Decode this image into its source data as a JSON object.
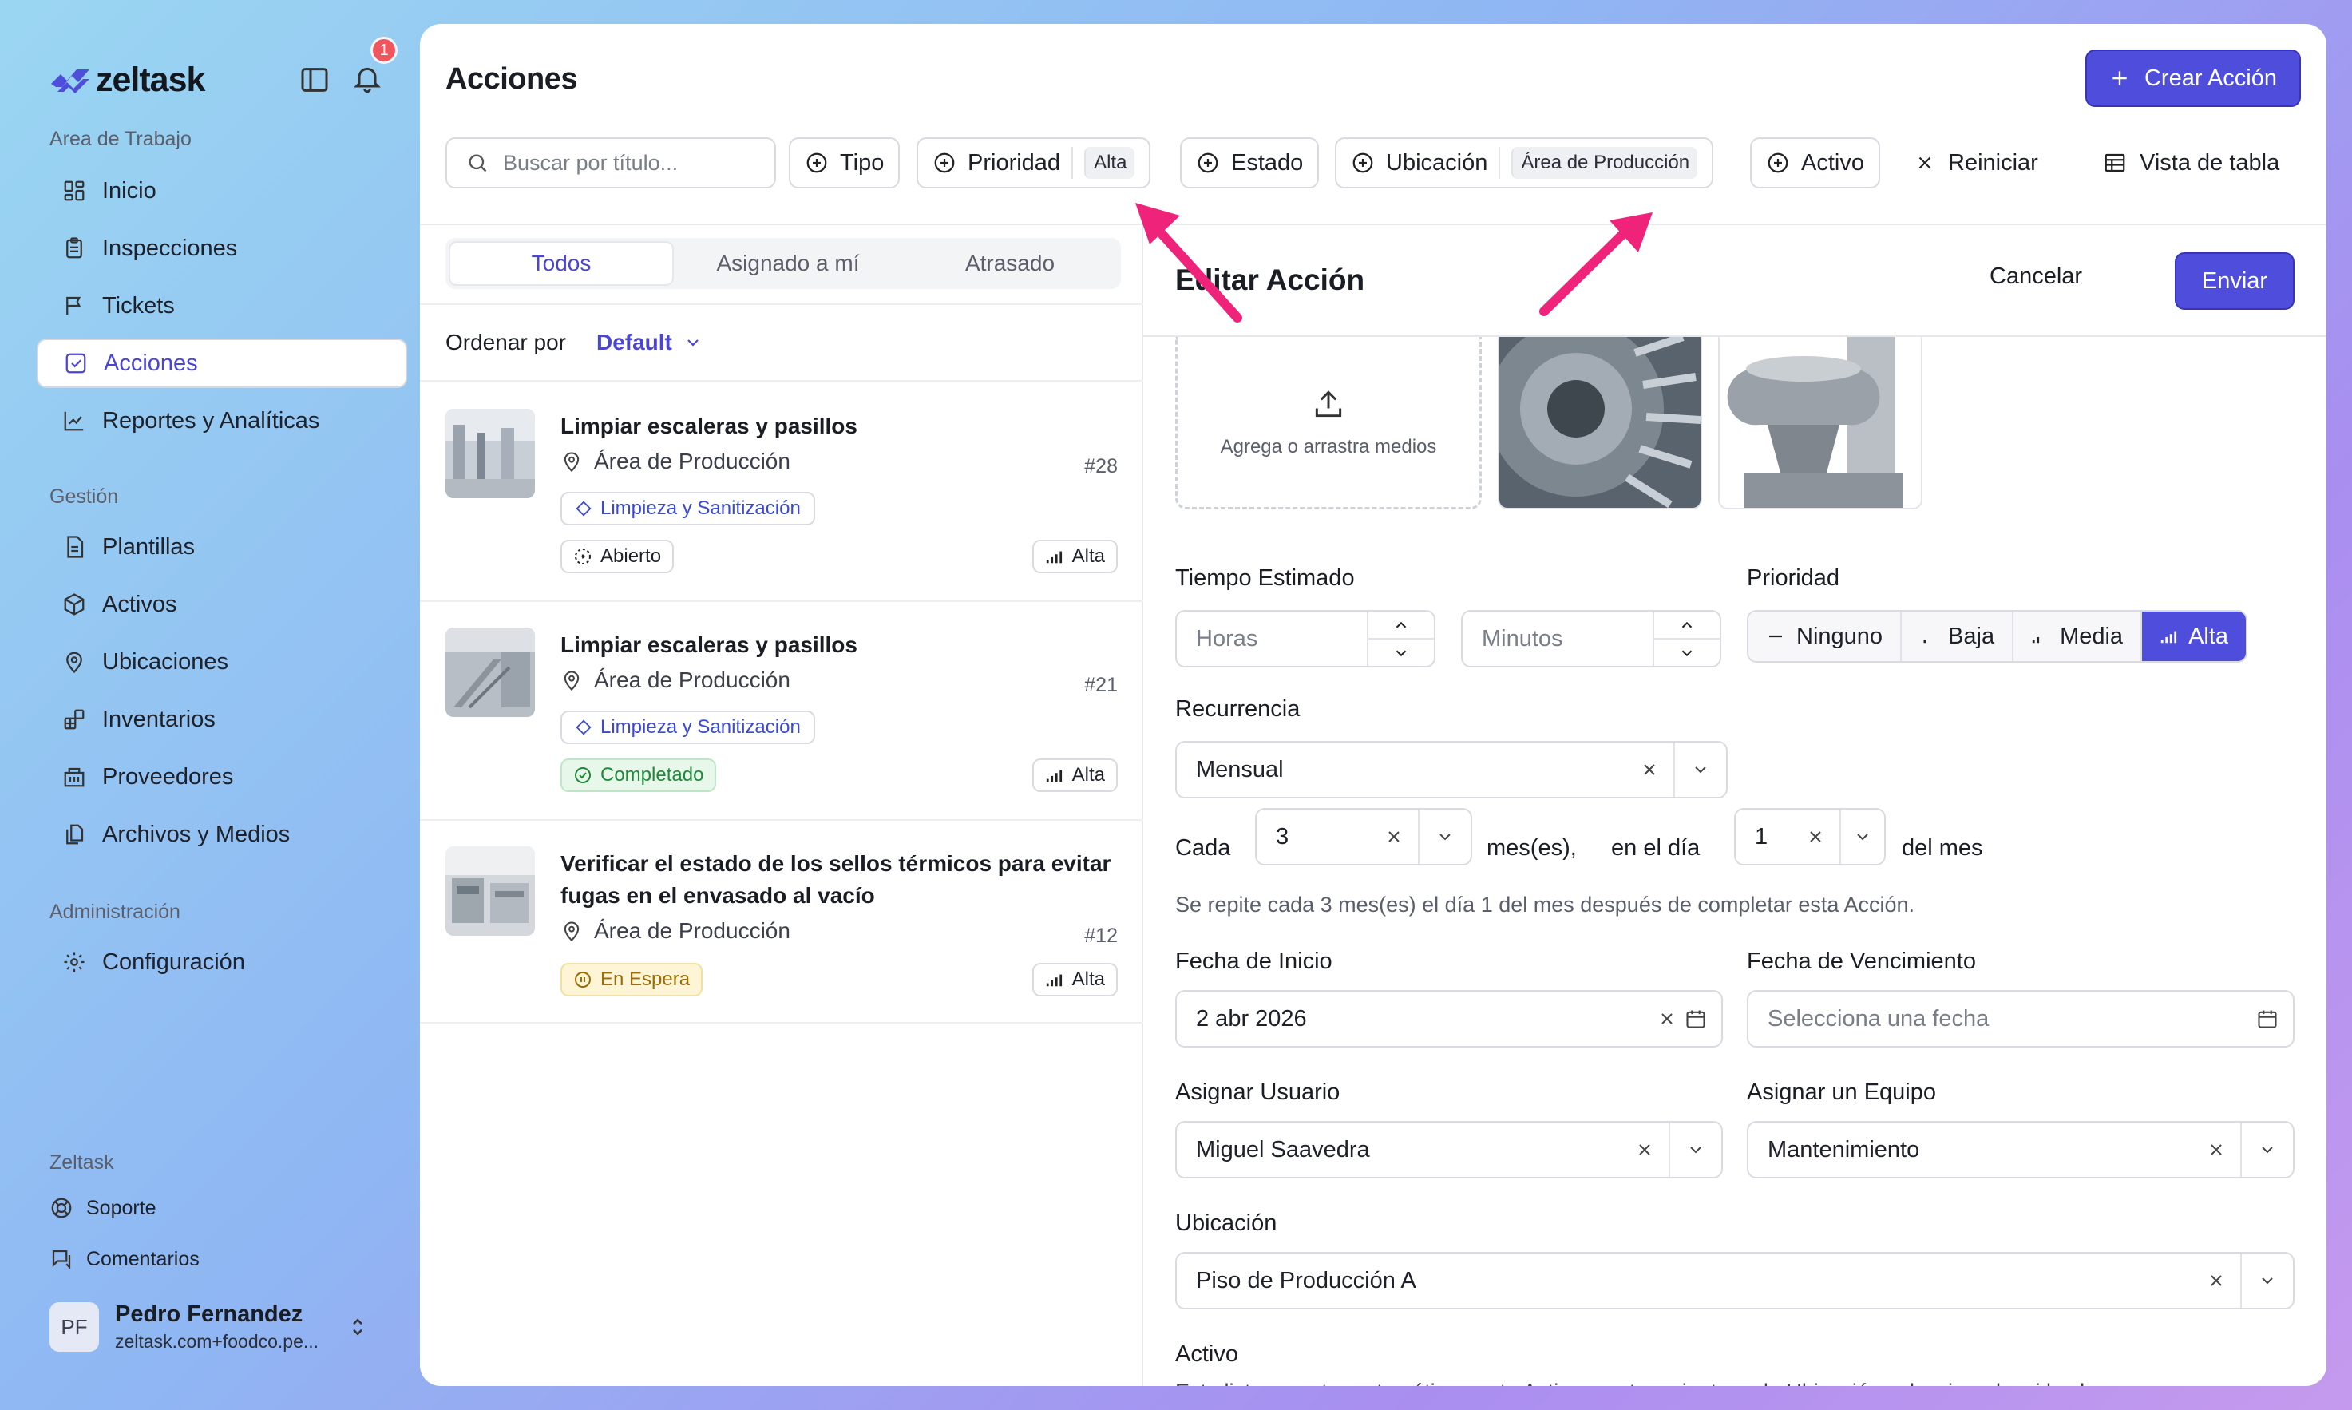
{
  "app": {
    "logo_text": "zeltask",
    "notification_count": "1",
    "brand_color": "#4f4ddc",
    "alert_color": "#f0565d",
    "annotation_color": "#f0237a"
  },
  "sidebar": {
    "workspace_label": "Area de Trabajo",
    "workspace_items": [
      {
        "label": "Inicio",
        "icon": "grid-icon"
      },
      {
        "label": "Inspecciones",
        "icon": "clipboard-icon"
      },
      {
        "label": "Tickets",
        "icon": "flag-icon"
      },
      {
        "label": "Acciones",
        "icon": "checkbox-icon",
        "active": true
      },
      {
        "label": "Reportes y Analíticas",
        "icon": "chart-line-icon"
      }
    ],
    "management_label": "Gestión",
    "management_items": [
      {
        "label": "Plantillas",
        "icon": "document-icon"
      },
      {
        "label": "Activos",
        "icon": "box-icon"
      },
      {
        "label": "Ubicaciones",
        "icon": "map-pin-icon"
      },
      {
        "label": "Inventarios",
        "icon": "blocks-icon"
      },
      {
        "label": "Proveedores",
        "icon": "building-icon"
      },
      {
        "label": "Archivos y Medios",
        "icon": "files-icon"
      }
    ],
    "admin_label": "Administración",
    "admin_items": [
      {
        "label": "Configuración",
        "icon": "gear-icon"
      }
    ],
    "footer_label": "Zeltask",
    "footer_items": [
      {
        "label": "Soporte",
        "icon": "lifebuoy-icon"
      },
      {
        "label": "Comentarios",
        "icon": "message-icon"
      }
    ],
    "user": {
      "initials": "PF",
      "name": "Pedro Fernandez",
      "email": "zeltask.com+foodco.pe..."
    }
  },
  "header": {
    "title": "Acciones",
    "create_label": "Crear Acción"
  },
  "filters": {
    "search_placeholder": "Buscar por título...",
    "tipo": "Tipo",
    "prioridad": "Prioridad",
    "prioridad_value": "Alta",
    "estado": "Estado",
    "ubicacion": "Ubicación",
    "ubicacion_value": "Área de Producción",
    "activo": "Activo",
    "reset": "Reiniciar",
    "table_view": "Vista de tabla"
  },
  "list": {
    "tabs": [
      "Todos",
      "Asignado a mí",
      "Atrasado"
    ],
    "active_tab": 0,
    "sort_label": "Ordenar por",
    "sort_value": "Default",
    "cards": [
      {
        "title": "Limpiar escaleras y pasillos",
        "location": "Área de Producción",
        "number": "#28",
        "category": "Limpieza y Sanitización",
        "status": "Abierto",
        "priority": "Alta"
      },
      {
        "title": "Limpiar escaleras y pasillos",
        "location": "Área de Producción",
        "number": "#21",
        "category": "Limpieza y Sanitización",
        "status": "Completado",
        "priority": "Alta"
      },
      {
        "title": "Verificar el estado de los sellos térmicos para evitar fugas en el envasado al vacío",
        "location": "Área de Producción",
        "number": "#12",
        "status": "En Espera",
        "priority": "Alta"
      }
    ]
  },
  "edit": {
    "title": "Editar Acción",
    "cancel": "Cancelar",
    "send": "Enviar",
    "upload_text": "Agrega o arrastra medios",
    "estimated_time_label": "Tiempo Estimado",
    "hours_placeholder": "Horas",
    "minutes_placeholder": "Minutos",
    "priority_label": "Prioridad",
    "priority_options": [
      "Ninguno",
      "Baja",
      "Media",
      "Alta"
    ],
    "priority_selected": "Alta",
    "recurrence_label": "Recurrencia",
    "recurrence_value": "Mensual",
    "every_label": "Cada",
    "every_value": "3",
    "months_label": "mes(es),",
    "on_day_label": "en el día",
    "day_value": "1",
    "of_month_label": "del mes",
    "recurrence_help": "Se repite cada 3 mes(es) el día 1 del mes después de completar esta Acción.",
    "start_date_label": "Fecha de Inicio",
    "start_date_value": "2 abr 2026",
    "due_date_label": "Fecha de Vencimiento",
    "due_date_placeholder": "Selecciona una fecha",
    "assign_user_label": "Asignar Usuario",
    "assign_user_value": "Miguel Saavedra",
    "assign_team_label": "Asignar un Equipo",
    "assign_team_value": "Mantenimiento",
    "location_label": "Ubicación",
    "location_value": "Piso de Producción A",
    "asset_label": "Activo",
    "asset_help": "Esta lista muestra automáticamente Activos pertenecientes a la Ubicación seleccionada, si los hay."
  }
}
